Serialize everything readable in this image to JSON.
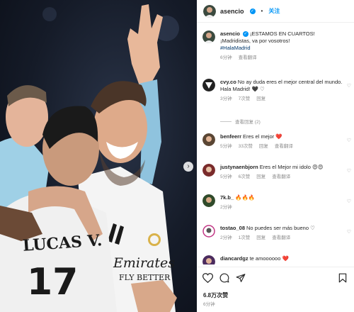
{
  "post": {
    "username": "asencio",
    "follow_label": "关注",
    "caption_line1": "¡ESTAMOS EN CUARTOS!",
    "caption_line2": "¡Madridistas, va por vosotros!",
    "hashtag": "#HalaMadrid",
    "caption_time": "6分钟",
    "caption_translate": "查看翻译",
    "likes": "6.8万次赞",
    "posted_time": "6分钟"
  },
  "photo": {
    "jersey_name": "LUCAS V.",
    "jersey_number": "17",
    "sponsor": "Emirates",
    "sponsor_line2": "FLY BETTER"
  },
  "comments": [
    {
      "username": "cvy.co",
      "text": "No ay duda eres el mejor central del mundo. Hala Madrid! 🖤 ♡",
      "time": "3分钟",
      "likes": "7次赞",
      "reply": "回复",
      "view_replies": "查看回复 (2)"
    },
    {
      "username": "benfeerr",
      "text": "Eres el mejor ❤️",
      "time": "5分钟",
      "likes": "33次赞",
      "reply": "回复",
      "translate": "查看翻译"
    },
    {
      "username": "justynaenbjorn",
      "text": "Eres el Mejor mi idolo 😍😍",
      "time": "5分钟",
      "likes": "6次赞",
      "reply": "回复",
      "translate": "查看翻译"
    },
    {
      "username": "7k.b_",
      "text": "🔥🔥🔥",
      "time": "2分钟"
    },
    {
      "username": "tostao_08",
      "text": "No puedes ser más bueno ♡",
      "time": "2分钟",
      "likes": "1次赞",
      "reply": "回复",
      "translate": "查看翻译"
    },
    {
      "username": "diancardgz",
      "text": "te amoooooo ❤️"
    }
  ],
  "icons": {
    "like": "heart-icon",
    "comment": "comment-icon",
    "share": "share-icon",
    "save": "bookmark-icon",
    "next": "chevron-right-icon"
  },
  "colors": {
    "accent": "#0095f6",
    "muted": "#8e8e8e",
    "hashtag": "#00376b"
  }
}
